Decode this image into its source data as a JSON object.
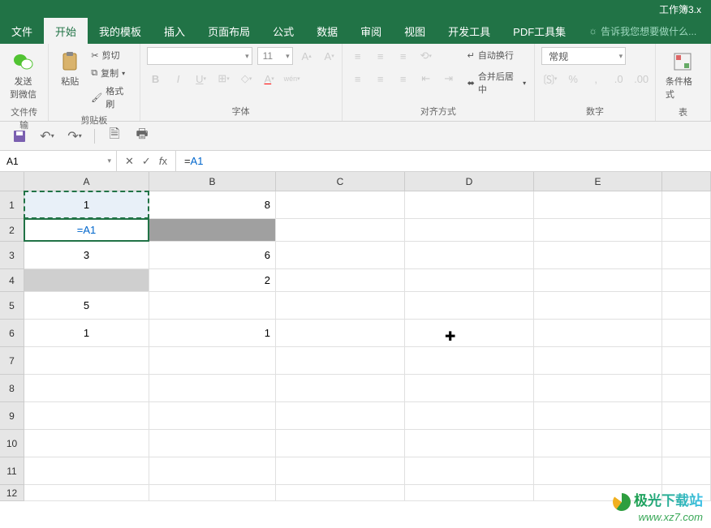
{
  "title": "工作簿3.x",
  "menu": {
    "file": "文件",
    "home": "开始",
    "template": "我的模板",
    "insert": "插入",
    "layout": "页面布局",
    "formula": "公式",
    "data": "数据",
    "review": "审阅",
    "view": "视图",
    "dev": "开发工具",
    "pdf": "PDF工具集",
    "tell": "告诉我您想要做什么..."
  },
  "ribbon": {
    "transfer": {
      "send": "发送",
      "wechat": "到微信",
      "label": "文件传输"
    },
    "clipboard": {
      "paste": "粘贴",
      "cut": "剪切",
      "copy": "复制",
      "format": "格式刷",
      "label": "剪贴板"
    },
    "font": {
      "name": "",
      "size": "11",
      "label": "字体"
    },
    "align": {
      "wrap": "自动换行",
      "merge": "合并后居中",
      "label": "对齐方式"
    },
    "number": {
      "style": "常规",
      "label": "数字"
    },
    "styles": {
      "cond": "条件格式",
      "more": "表"
    }
  },
  "formulaBar": {
    "nameBox": "A1",
    "formula": "=A1"
  },
  "columns": [
    "A",
    "B",
    "C",
    "D",
    "E"
  ],
  "rows": [
    "1",
    "2",
    "3",
    "4",
    "5",
    "6",
    "7",
    "8",
    "9",
    "10",
    "11",
    "12"
  ],
  "cells": {
    "A1": "1",
    "B1": "8",
    "A2": "=A1",
    "A3": "3",
    "B3": "6",
    "B4": "2",
    "A5": "5",
    "A6": "1",
    "B6": "1"
  },
  "watermark": {
    "line1": "极光下载站",
    "line2": "www.xz7.com"
  }
}
